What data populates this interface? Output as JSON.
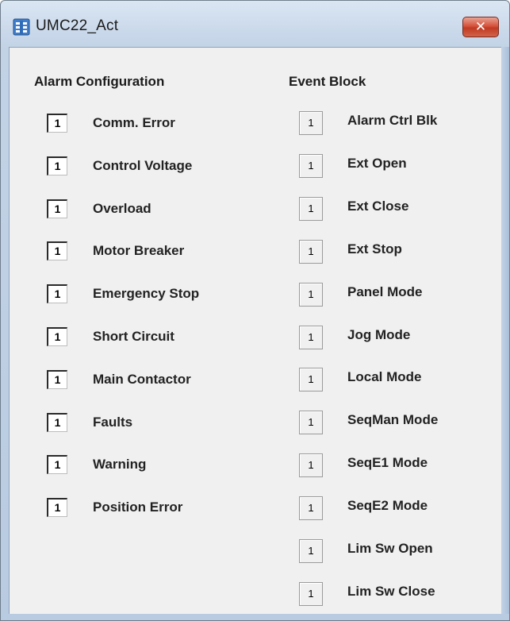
{
  "window": {
    "title": "UMC22_Act",
    "close_glyph": "✕",
    "icon": "app-window-icon"
  },
  "alarm_configuration": {
    "heading": "Alarm Configuration",
    "items": [
      {
        "value": "1",
        "label": "Comm. Error"
      },
      {
        "value": "1",
        "label": "Control Voltage"
      },
      {
        "value": "1",
        "label": "Overload"
      },
      {
        "value": "1",
        "label": "Motor Breaker"
      },
      {
        "value": "1",
        "label": "Emergency Stop"
      },
      {
        "value": "1",
        "label": "Short Circuit"
      },
      {
        "value": "1",
        "label": "Main Contactor"
      },
      {
        "value": "1",
        "label": "Faults"
      },
      {
        "value": "1",
        "label": "Warning"
      },
      {
        "value": "1",
        "label": "Position Error"
      }
    ]
  },
  "event_block": {
    "heading": "Event Block",
    "items": [
      {
        "value": "1",
        "label": "Alarm Ctrl Blk"
      },
      {
        "value": "1",
        "label": "Ext Open"
      },
      {
        "value": "1",
        "label": "Ext Close"
      },
      {
        "value": "1",
        "label": "Ext Stop"
      },
      {
        "value": "1",
        "label": "Panel Mode"
      },
      {
        "value": "1",
        "label": "Jog Mode"
      },
      {
        "value": "1",
        "label": "Local Mode"
      },
      {
        "value": "1",
        "label": "SeqMan Mode"
      },
      {
        "value": "1",
        "label": "SeqE1 Mode"
      },
      {
        "value": "1",
        "label": "SeqE2 Mode"
      },
      {
        "value": "1",
        "label": "Lim Sw Open"
      },
      {
        "value": "1",
        "label": "Lim Sw Close"
      }
    ]
  }
}
